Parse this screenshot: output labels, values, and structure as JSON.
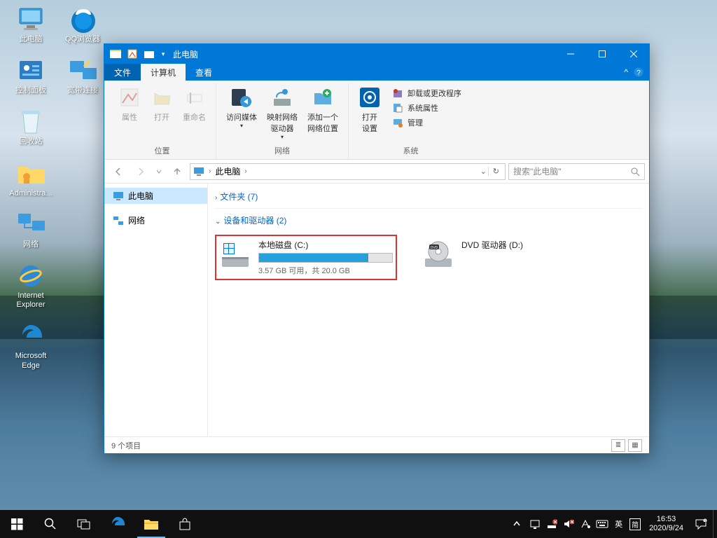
{
  "desktop": {
    "col1": [
      {
        "label": "此电脑",
        "icon": "pc"
      },
      {
        "label": "控制面板",
        "icon": "cpanel"
      },
      {
        "label": "回收站",
        "icon": "bin"
      },
      {
        "label": "Administra...",
        "icon": "folder"
      },
      {
        "label": "网络",
        "icon": "network"
      },
      {
        "label": "Internet Explorer",
        "icon": "ie"
      },
      {
        "label": "Microsoft Edge",
        "icon": "edge"
      }
    ],
    "col2": [
      {
        "label": "QQ浏览器",
        "icon": "qq"
      },
      {
        "label": "宽带连接",
        "icon": "broadband"
      }
    ]
  },
  "window": {
    "title": "此电脑",
    "tabs": {
      "file": "文件",
      "computer": "计算机",
      "view": "查看"
    },
    "ribbon": {
      "group_location": "位置",
      "group_network": "网络",
      "group_system": "系统",
      "properties": "属性",
      "open": "打开",
      "rename": "重命名",
      "access_media": "访问媒体",
      "map_drive": "映射网络\n驱动器",
      "add_loc": "添加一个\n网络位置",
      "open_settings": "打开\n设置",
      "uninstall": "卸载或更改程序",
      "sys_props": "系统属性",
      "manage": "管理"
    },
    "address": {
      "root": "此电脑"
    },
    "search_placeholder": "搜索\"此电脑\"",
    "sidebar": {
      "this_pc": "此电脑",
      "network": "网络"
    },
    "sections": {
      "folders": "文件夹 (7)",
      "devices": "设备和驱动器 (2)"
    },
    "drive_c": {
      "name": "本地磁盘 (C:)",
      "sub": "3.57 GB 可用，共 20.0 GB",
      "fill_pct": 82
    },
    "drive_d": {
      "name": "DVD 驱动器 (D:)"
    },
    "status": "9 个项目"
  },
  "taskbar": {
    "ime": "英",
    "ime2": "简",
    "time": "16:53",
    "date": "2020/9/24"
  }
}
